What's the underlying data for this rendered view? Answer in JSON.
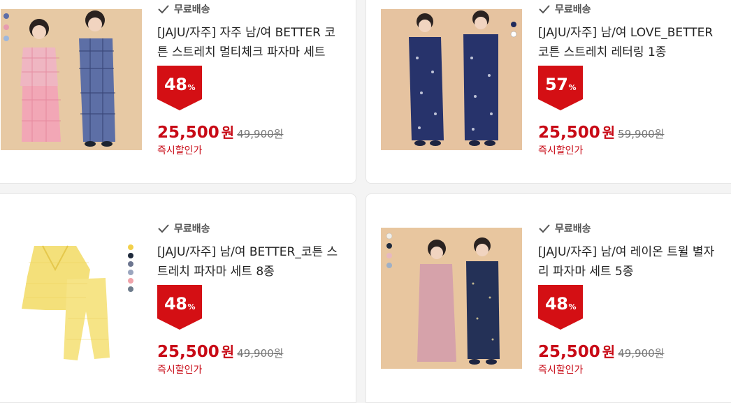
{
  "colors": {
    "accent": "#c80a16",
    "badge": "#d40f14"
  },
  "products": [
    {
      "shipping": "무료배송",
      "title": "[JAJU/자주] 자주 남/여 BETTER 코튼 스트레치 멀티체크 파자마 세트",
      "discount": "48",
      "percent": "%",
      "price": "25,500",
      "won": "원",
      "original": "49,900원",
      "sub_label": "즉시할인가",
      "image_icon": "pajama-photo-pink-blue-check"
    },
    {
      "shipping": "무료배송",
      "title": "[JAJU/자주] 남/여 LOVE_BETTER 코튼 스트레치 레터링 1종",
      "discount": "57",
      "percent": "%",
      "price": "25,500",
      "won": "원",
      "original": "59,900원",
      "sub_label": "즉시할인가",
      "image_icon": "pajama-photo-navy-couple"
    },
    {
      "shipping": "무료배송",
      "title": "[JAJU/자주] 남/여 BETTER_코튼 스트레치 파자마 세트 8종",
      "discount": "48",
      "percent": "%",
      "price": "25,500",
      "won": "원",
      "original": "49,900원",
      "sub_label": "즉시할인가",
      "image_icon": "pajama-photo-yellow-set"
    },
    {
      "shipping": "무료배송",
      "title": "[JAJU/자주] 남/여 레이온 트윌 별자리 파자마 세트 5종",
      "discount": "48",
      "percent": "%",
      "price": "25,500",
      "won": "원",
      "original": "49,900원",
      "sub_label": "즉시할인가",
      "image_icon": "pajama-photo-rose-navy-couple"
    }
  ]
}
